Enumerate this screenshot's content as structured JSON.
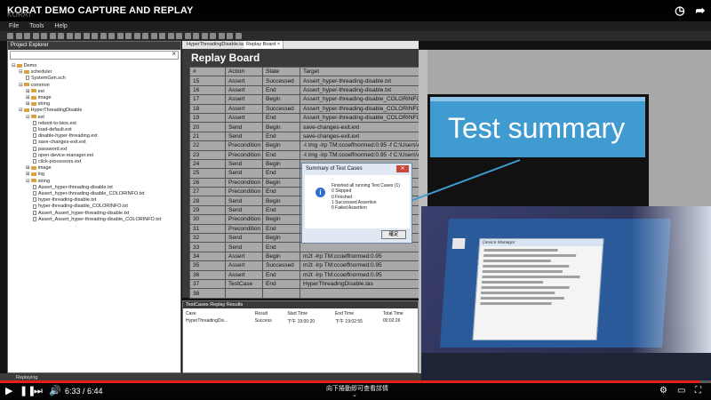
{
  "video": {
    "title": "KORAT DEMO CAPTURE AND REPLAY",
    "watermark": "KORAT",
    "progress_fraction": 0.985,
    "time": "6:33 / 6:44",
    "hint": "向下捲動即可查看詳情",
    "chevron": "⌄",
    "icons": [
      "clock-icon",
      "share-icon",
      "play-icon",
      "next-icon",
      "volume-icon",
      "settings-icon",
      "fullscreen-icon"
    ]
  },
  "app": {
    "menu": [
      "File",
      "Tools",
      "Help"
    ],
    "explorer": {
      "header": "Project Explorer",
      "search_clear": "×",
      "tree": [
        {
          "depth": 0,
          "kind": "folder",
          "label": "Demo",
          "exp": "⊟"
        },
        {
          "depth": 1,
          "kind": "folder",
          "label": "scheduler",
          "exp": "⊟"
        },
        {
          "depth": 2,
          "kind": "file",
          "label": "SystemGen.sch",
          "exp": ""
        },
        {
          "depth": 1,
          "kind": "folder",
          "label": "common",
          "exp": "⊟"
        },
        {
          "depth": 2,
          "kind": "folder",
          "label": "ext",
          "exp": "⊞"
        },
        {
          "depth": 2,
          "kind": "folder",
          "label": "image",
          "exp": "⊞"
        },
        {
          "depth": 2,
          "kind": "folder",
          "label": "string",
          "exp": "⊞"
        },
        {
          "depth": 1,
          "kind": "folder",
          "label": "HyperThreadingDisable",
          "exp": "⊟"
        },
        {
          "depth": 2,
          "kind": "folder",
          "label": "ext",
          "exp": "⊟"
        },
        {
          "depth": 3,
          "kind": "file",
          "label": "reboot-to-bios.ext",
          "exp": ""
        },
        {
          "depth": 3,
          "kind": "file",
          "label": "load-default.ext",
          "exp": ""
        },
        {
          "depth": 3,
          "kind": "file",
          "label": "disable-hyper-threading.ext",
          "exp": ""
        },
        {
          "depth": 3,
          "kind": "file",
          "label": "save-changes-exit.ext",
          "exp": ""
        },
        {
          "depth": 3,
          "kind": "file",
          "label": "password.ext",
          "exp": ""
        },
        {
          "depth": 3,
          "kind": "file",
          "label": "open-device-manager.ext",
          "exp": ""
        },
        {
          "depth": 3,
          "kind": "file",
          "label": "click-processors.ext",
          "exp": ""
        },
        {
          "depth": 2,
          "kind": "folder",
          "label": "image",
          "exp": "⊞"
        },
        {
          "depth": 2,
          "kind": "folder",
          "label": "log",
          "exp": "⊞"
        },
        {
          "depth": 2,
          "kind": "folder",
          "label": "string",
          "exp": "⊟"
        },
        {
          "depth": 3,
          "kind": "file",
          "label": "Assert_hyper-threading-disable.txt",
          "exp": ""
        },
        {
          "depth": 3,
          "kind": "file",
          "label": "Assert_hyper-threading-disable_COLORINFO.txt",
          "exp": ""
        },
        {
          "depth": 3,
          "kind": "file",
          "label": "hyper-threading-disable.txt",
          "exp": ""
        },
        {
          "depth": 3,
          "kind": "file",
          "label": "hyper-threading-disable_COLORINFO.txt",
          "exp": ""
        },
        {
          "depth": 3,
          "kind": "file",
          "label": "Assert_Assert_hyper-threading-disable.txt",
          "exp": ""
        },
        {
          "depth": 3,
          "kind": "file",
          "label": "Assert_Assert_hyper-threading-disable_COLORINFO.txt",
          "exp": ""
        }
      ]
    },
    "tabs": [
      {
        "label": "HyperThreadingDisable.tas",
        "active": false
      },
      {
        "label": "Replay Board",
        "active": true,
        "close": "×"
      }
    ],
    "replay_board": {
      "title": "Replay Board",
      "columns": [
        "#",
        "Action",
        "State",
        "Target"
      ],
      "rows": [
        [
          "15",
          "Assert",
          "Successed",
          "Assert_hyper-threading-disable.txt"
        ],
        [
          "16",
          "Assert",
          "End",
          "Assert_hyper-threading-disable.txt"
        ],
        [
          "17",
          "Assert",
          "Begin",
          "Assert_hyper-threading-disable_COLORINFO.txt"
        ],
        [
          "18",
          "Assert",
          "Successed",
          "Assert_hyper-threading-disable_COLORINFO.txt"
        ],
        [
          "19",
          "Assert",
          "End",
          "Assert_hyper-threading-disable_COLORINFO.txt"
        ],
        [
          "20",
          "Send",
          "Begin",
          "save-changes-exit.ext"
        ],
        [
          "21",
          "Send",
          "End",
          "save-changes-exit.ext"
        ],
        [
          "22",
          "Precondition",
          "Begin",
          "-t img -lrp TM:ccoeffnormed:0.95 -f C:\\Users\\oolab..."
        ],
        [
          "23",
          "Precondition",
          "End",
          "-t img -lrp TM:ccoeffnormed:0.95 -f C:\\Users\\oolab..."
        ],
        [
          "24",
          "Send",
          "Begin",
          ""
        ],
        [
          "25",
          "Send",
          "End",
          ""
        ],
        [
          "26",
          "Precondition",
          "Begin",
          ""
        ],
        [
          "27",
          "Precondition",
          "End",
          ""
        ],
        [
          "28",
          "Send",
          "Begin",
          ""
        ],
        [
          "29",
          "Send",
          "End",
          ""
        ],
        [
          "30",
          "Precondition",
          "Begin",
          ""
        ],
        [
          "31",
          "Precondition",
          "End",
          ""
        ],
        [
          "32",
          "Send",
          "Begin",
          ""
        ],
        [
          "33",
          "Send",
          "End",
          ""
        ],
        [
          "34",
          "Assert",
          "Begin",
          "m2t -lrp TM:ccoeffnormed:0.95"
        ],
        [
          "35",
          "Assert",
          "Successed",
          "m2t -lrp TM:ccoeffnormed:0.95"
        ],
        [
          "36",
          "Assert",
          "End",
          "m2t -lrp TM:ccoeffnormed:0.95"
        ],
        [
          "37",
          "TestCase",
          "End",
          "HyperThreadingDisable.tas"
        ],
        [
          "38",
          "",
          "",
          ""
        ]
      ]
    },
    "results": {
      "header": "TestCases Replay Results",
      "columns": [
        "Case",
        "Result",
        "Start Time",
        "End Time",
        "Total Time"
      ],
      "rows": [
        [
          "HyperThreadingDis...",
          "Success",
          "下午 19:00:20",
          "下午 19:02:55",
          "00:02:26"
        ]
      ]
    },
    "status": "Replaying"
  },
  "dialog": {
    "title": "Summary of Test Cases",
    "close": "✕",
    "icon": "i",
    "lines": [
      "Finished all running Test Cases (1)",
      "0 Skipped",
      "0 Finished",
      "1 Successed Assertion",
      "0 Failed Assertion"
    ],
    "ok": "確定"
  },
  "overlay": {
    "text": "Test summary",
    "color": "#3f9bd0"
  },
  "camera": {
    "window_title": "Device Manager",
    "recycle_bin": "Recycle Bin"
  }
}
